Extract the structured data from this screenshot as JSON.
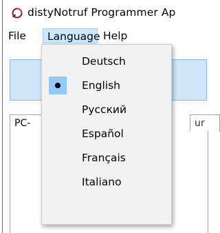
{
  "window": {
    "title": "distyNotruf Programmer Ap",
    "icon": "app-logo-icon"
  },
  "menubar": {
    "file_label": "File",
    "language_label": "Language",
    "help_label": "Help"
  },
  "tabs": {
    "tab1_label": "PC-",
    "tab2_label": "ur"
  },
  "language_menu": {
    "items": [
      {
        "label": "Deutsch",
        "selected": false
      },
      {
        "label": "English",
        "selected": true
      },
      {
        "label": "Русский",
        "selected": false
      },
      {
        "label": "Español",
        "selected": false
      },
      {
        "label": "Français",
        "selected": false
      },
      {
        "label": "Italiano",
        "selected": false
      }
    ],
    "selected_color": "#91c9f7",
    "menu_hover_color": "#cce8ff"
  }
}
